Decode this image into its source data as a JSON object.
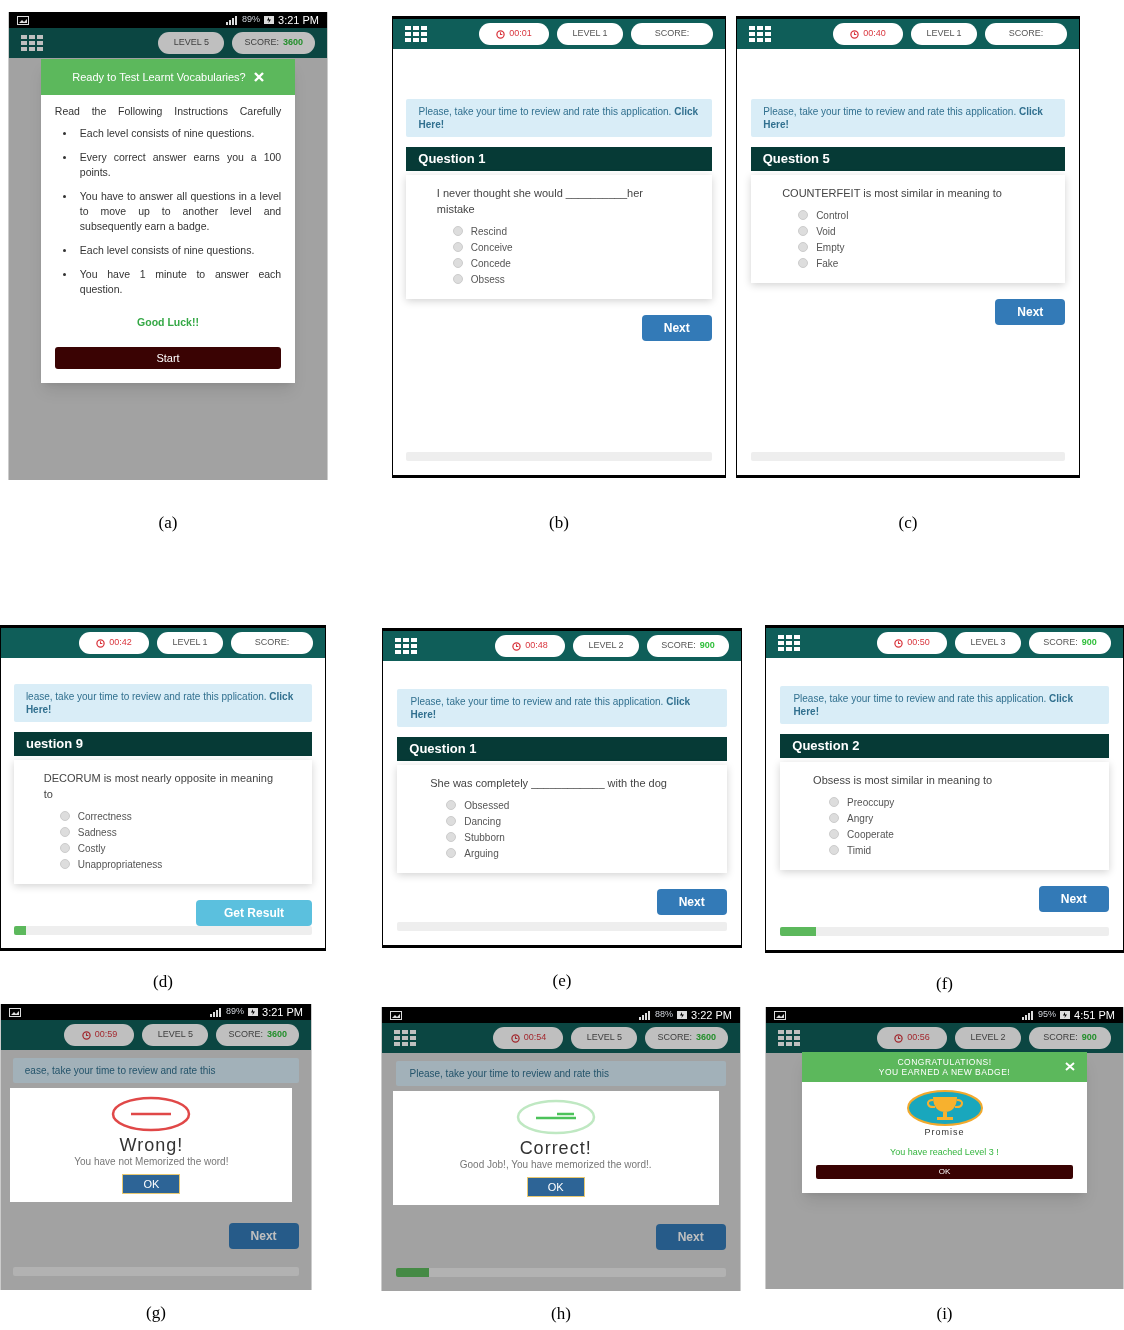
{
  "panels": [
    {
      "caption": "(a)",
      "status_bar": {
        "battery": "89%",
        "time": "3:21 PM"
      },
      "header": {
        "menu": true,
        "level": "LEVEL 5",
        "score_label": "SCORE:",
        "score_value": "3600"
      },
      "dimmed": true,
      "dialog": {
        "kind": "instructions",
        "title": "Ready to Test Learnt Vocabularies?",
        "intro": "Read the Following Instructions Carefully",
        "bullets": [
          "Each level consists of nine questions.",
          "Every correct answer earns you a 100 points.",
          "You have to answer all questions in a level to move up to another level and subsequently earn a badge.",
          "Each level consists of nine questions.",
          "You have 1 minute to answer each question."
        ],
        "closing": "Good Luck!!",
        "button": "Start"
      }
    },
    {
      "caption": "(b)",
      "header": {
        "menu": true,
        "timer": "00:01",
        "level": "LEVEL 1",
        "score_label": "SCORE:"
      },
      "dimmed": false,
      "notice": "Please, take your time to review and rate this application. **Click Here!**",
      "question": {
        "title": "Question 1",
        "text": "I never thought she would __________her mistake",
        "options": [
          {
            "label": "Rescind",
            "selected": false
          },
          {
            "label": "Conceive",
            "selected": false
          },
          {
            "label": "Concede",
            "selected": false
          },
          {
            "label": "Obsess",
            "selected": false
          }
        ]
      },
      "button": {
        "kind": "next",
        "label": "Next"
      },
      "progress": {
        "level": 0
      }
    },
    {
      "caption": "(c)",
      "header": {
        "menu": true,
        "timer": "00:40",
        "level": "LEVEL 1",
        "score_label": "SCORE:"
      },
      "dimmed": false,
      "notice": "Please, take your time to review and rate this application. **Click Here!**",
      "question": {
        "title": "Question 5",
        "text": "COUNTERFEIT is most similar in meaning to",
        "options": [
          {
            "label": "Control",
            "selected": false
          },
          {
            "label": "Void",
            "selected": false
          },
          {
            "label": "Empty",
            "selected": false
          },
          {
            "label": "Fake",
            "selected": false
          }
        ]
      },
      "button": {
        "kind": "next",
        "label": "Next"
      },
      "progress": {
        "level": 0
      }
    },
    {
      "caption": "(d)",
      "header": {
        "menu": false,
        "timer": "00:42",
        "level": "LEVEL 1",
        "score_label": "SCORE:"
      },
      "dimmed": false,
      "notice": "lease, take your time to review and rate this pplication. **Click Here!**",
      "question": {
        "title": "uestion 9",
        "text": "DECORUM is most nearly opposite in meaning to",
        "options": [
          {
            "label": "Correctness",
            "selected": false
          },
          {
            "label": "Sadness",
            "selected": false
          },
          {
            "label": "Costly",
            "selected": false
          },
          {
            "label": "Unappropriateness",
            "selected": false
          }
        ]
      },
      "button": {
        "kind": "result",
        "label": "Get Result"
      },
      "progress": {
        "level": 0.04
      }
    },
    {
      "caption": "(e)",
      "header": {
        "menu": true,
        "timer": "00:48",
        "level": "LEVEL 2",
        "score_label": "SCORE:",
        "score_value": "900"
      },
      "dimmed": false,
      "notice": "Please, take your time to review and rate this application. **Click Here!**",
      "question": {
        "title": "Question 1",
        "text": "She was completely ____________ with the dog",
        "options": [
          {
            "label": "Obsessed",
            "selected": false
          },
          {
            "label": "Dancing",
            "selected": false
          },
          {
            "label": "Stubborn",
            "selected": false
          },
          {
            "label": "Arguing",
            "selected": false
          }
        ]
      },
      "button": {
        "kind": "next",
        "label": "Next"
      },
      "progress": {
        "level": 0
      }
    },
    {
      "caption": "(f)",
      "header": {
        "menu": true,
        "timer": "00:50",
        "level": "LEVEL 3",
        "score_label": "SCORE:",
        "score_value": "900"
      },
      "dimmed": false,
      "notice": "Please, take your time to review and rate this application. **Click Here!**",
      "question": {
        "title": "Question 2",
        "text": "Obsess is most similar in meaning to",
        "options": [
          {
            "label": "Preoccupy",
            "selected": false
          },
          {
            "label": "Angry",
            "selected": false
          },
          {
            "label": "Cooperate",
            "selected": false
          },
          {
            "label": "Timid",
            "selected": false
          }
        ]
      },
      "button": {
        "kind": "next",
        "label": "Next"
      },
      "progress": {
        "level": 0.11
      }
    },
    {
      "caption": "(g)",
      "status_bar": {
        "battery": "89%",
        "time": "3:21 PM"
      },
      "header": {
        "menu": false,
        "timer": "00:59",
        "level": "LEVEL 5",
        "score_label": "SCORE:",
        "score_value": "3600"
      },
      "dimmed": true,
      "notice": "ease, take your time to review and rate this",
      "dialog": {
        "kind": "wrong",
        "title": "Wrong!",
        "message": "You have not Memorized the word!",
        "button": "OK"
      },
      "button": {
        "kind": "next",
        "label": "Next"
      },
      "progress": {
        "level": 0
      }
    },
    {
      "caption": "(h)",
      "status_bar": {
        "battery": "88%",
        "time": "3:22 PM"
      },
      "header": {
        "menu": true,
        "timer": "00:54",
        "level": "LEVEL 5",
        "score_label": "SCORE:",
        "score_value": "3600"
      },
      "dimmed": true,
      "notice": "Please, take your time to review and rate this",
      "dialog": {
        "kind": "correct",
        "title": "Correct!",
        "message": "Good Job!, You have memorized the word!.",
        "button": "OK"
      },
      "button": {
        "kind": "next",
        "label": "Next"
      },
      "progress": {
        "level": 0.1
      }
    },
    {
      "caption": "(i)",
      "status_bar": {
        "battery": "95%",
        "time": "4:51 PM"
      },
      "header": {
        "menu": true,
        "timer": "00:56",
        "level": "LEVEL 2",
        "score_label": "SCORE:",
        "score_value": "900"
      },
      "dimmed": true,
      "dialog": {
        "kind": "badge",
        "title": "CONGRATULATIONS!\nYOU EARNED A NEW BADGE!",
        "badge": "Promise",
        "message": "You have reached Level 3 !",
        "button": "OK"
      }
    }
  ]
}
